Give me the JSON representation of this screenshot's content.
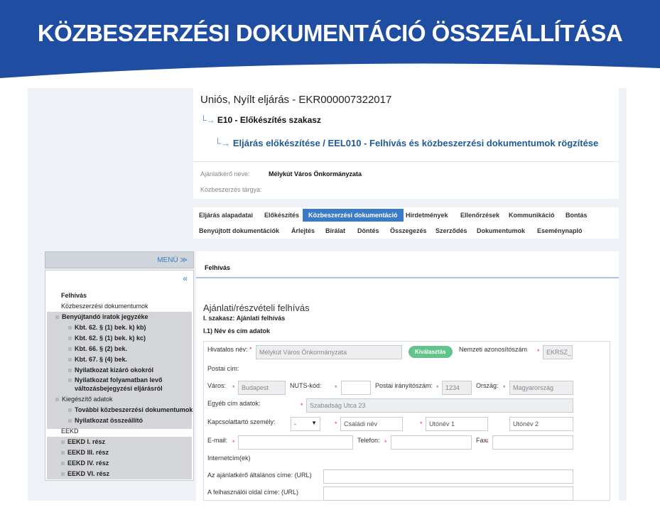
{
  "banner": {
    "title": "KÖZBESZERZÉSI DOKUMENTÁCIÓ ÖSSZEÁLLÍTÁSA",
    "color": "#1e4da1"
  },
  "procedure": {
    "title": "Uniós, Nyílt eljárás - EKR000007322017",
    "stage": "E10 - Előkészítés szakasz",
    "task": "Eljárás előkészítése / EEL010 - Felhívás és közbeszerzési dokumentumok rögzítése"
  },
  "meta": {
    "requester_label": "Ajánlatkérő neve:",
    "requester_value": "Mélykút Város Önkormányzata",
    "subject_label": "Közbeszerzés tárgya:"
  },
  "tabs": {
    "row1": [
      "Eljárás alapadatai",
      "Előkészítés",
      "Közbeszerzési dokumentáció",
      "Hirdetmények",
      "Ellenőrzések",
      "Kommunikáció",
      "Bontás"
    ],
    "row2": [
      "Benyújtott dokumentációk",
      "Árlejtés",
      "Bírálat",
      "Döntés",
      "Összegezés",
      "Szerződés",
      "Dokumentumok",
      "Eseménynapló"
    ],
    "active": "Közbeszerzési dokumentáció"
  },
  "sidebar": {
    "menu_label": "MENÜ ≫",
    "collapse": "«",
    "items": [
      "Felhívás",
      "Közbeszerzési dokumentumok",
      "Benyújtandó iratok jegyzéke",
      "Kbt. 62. § (1) bek. k) kb)",
      "Kbt. 62. § (1) bek. k) kc)",
      "Kbt. 66. § (2) bek.",
      "Kbt. 67. § (4) bek.",
      "Nyilatkozat kizáró okokról",
      "Nyilatkozat folyamatban levő",
      "változásbejegyzési eljárásról",
      "Kiegészítő adatok",
      "További közbeszerzési dokumentumok",
      "Nyilatkozat összeállító",
      "EEKD",
      "EEKD I. rész",
      "EEKD III. rész",
      "EEKD IV. rész",
      "EEKD VI. rész"
    ]
  },
  "main": {
    "tab_label": "Felhívás",
    "section_title": "Ajánlati/részvételi felhívás",
    "section_sub": "I. szakasz: Ajánlati felhívás",
    "subsection": "I.1) Név és cím adatok"
  },
  "form": {
    "official_name_label": "Hivatalos név:",
    "official_name_value": "Mélykút Város Önkormányzata",
    "select_button": "Kiválasztás",
    "national_id_label": "Nemzeti azonosítószám",
    "national_id_value": "EKRSZ_",
    "postal_label": "Postai cím:",
    "city_label": "Város:",
    "city_value": "Budapest",
    "nuts_label": "NUTS-kód:",
    "zip_label": "Postai irányítószám:",
    "zip_value": "1234",
    "country_label": "Ország:",
    "country_value": "Magyarország",
    "other_address_label": "Egyéb cím adatok:",
    "other_address_value": "Szabadság Utca 23",
    "contact_label": "Kapcsolattartó személy:",
    "contact_prefix": "-",
    "family_name_placeholder": "Családi név",
    "given_name1_placeholder": "Utónév 1",
    "given_name2_placeholder": "Utónév 2",
    "email_label": "E-mail:",
    "phone_label": "Telefon:",
    "fax_label": "Fax:",
    "internet_label": "Internetcím(ek)",
    "general_url_label": "Az ajánlatkérő általános címe: (URL)",
    "profile_url_label": "A felhasználói oldal címe: (URL)"
  }
}
